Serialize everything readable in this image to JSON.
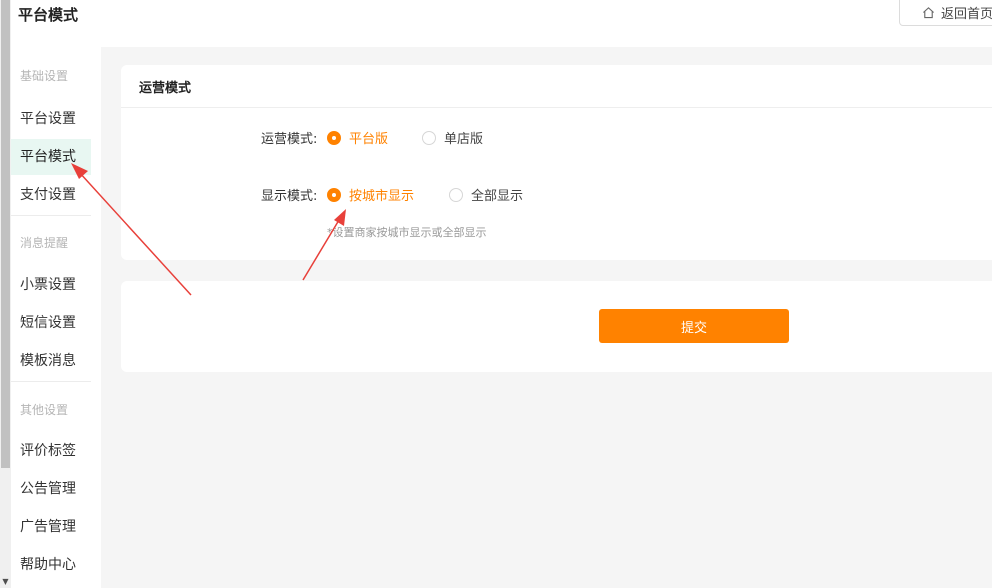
{
  "header": {
    "title": "平台模式",
    "home_button_label": "返回首页"
  },
  "sidebar": {
    "groups": [
      {
        "title": "基础设置",
        "items": [
          "平台设置",
          "平台模式",
          "支付设置"
        ]
      },
      {
        "title": "消息提醒",
        "items": [
          "小票设置",
          "短信设置",
          "模板消息"
        ]
      },
      {
        "title": "其他设置",
        "items": [
          "评价标签",
          "公告管理",
          "广告管理",
          "帮助中心"
        ]
      }
    ],
    "active_item": "平台模式"
  },
  "card": {
    "title": "运营模式",
    "operation_mode": {
      "label": "运营模式:",
      "options": [
        "平台版",
        "单店版"
      ],
      "selected": "平台版"
    },
    "display_mode": {
      "label": "显示模式:",
      "options": [
        "按城市显示",
        "全部显示"
      ],
      "selected": "按城市显示",
      "hint": "*设置商家按城市显示或全部显示"
    }
  },
  "submit_label": "提交",
  "colors": {
    "accent": "#ff8200",
    "active_bg": "#e8f7f2",
    "annotation_arrow": "#e8403a"
  }
}
